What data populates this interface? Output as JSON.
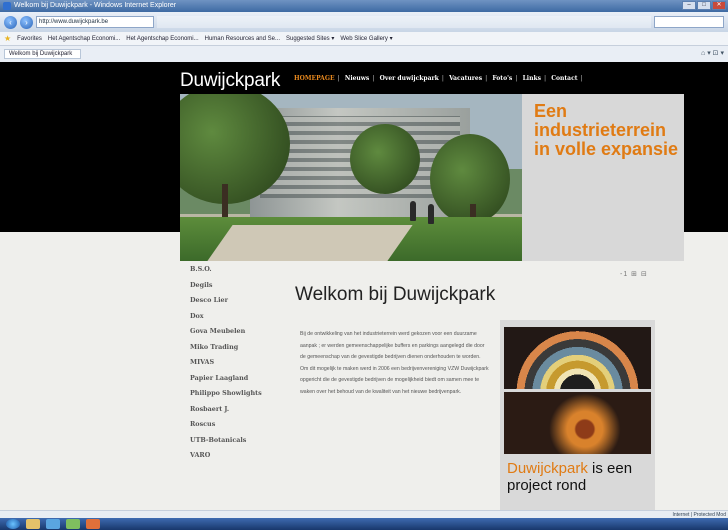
{
  "browser": {
    "title": "Welkom bij Duwijckpark - Windows Internet Explorer",
    "url": "http://www.duwijckpark.be",
    "favorites_label": "Favorites",
    "favorites": [
      "Het Agentschap Economi...",
      "Het Agentschap Economi...",
      "Human Resources and Se...",
      "Suggested Sites ▾",
      "Web Slice Gallery ▾"
    ],
    "tab_label": "Welkom bij Duwijckpark",
    "status_zone": "Internet | Protected Mod"
  },
  "site": {
    "logo": "Duwijckpark",
    "nav": [
      "HOMEPAGE",
      "Nieuws",
      "Over duwijckpark",
      "Vacatures",
      "Foto's",
      "Links",
      "Contact"
    ],
    "hero_tagline": "Een industrieterrein in volle expansie",
    "sidebar": [
      "B.S.O.",
      "Degils",
      "Desco Lier",
      "Dox",
      "Gova Meubelen",
      "Miko Trading",
      "MIVAS",
      "Papier Laagland",
      "Philippo Showlights",
      "Rosbaert J.",
      "Roscus",
      "UTB-Botanicals",
      "VARO"
    ],
    "page_title": "Welkom bij Duwijckpark",
    "intro_meta": "-1 ⊞ ⊟",
    "body": "Bij de ontwikkeling van het industrieterrein werd gekozen voor een duurzame aanpak ; er werden gemeenschappelijke buffers en parkings aangelegd die door de gemeenschap van de gevestigde bedrijven dienen onderhouden te worden. Om dit mogelijk te maken werd in 2006 een bedrijvenvereniging VZW Duwijckpark opgericht die de gevestigde bedrijven de mogelijkheid biedt om samen mee te waken over het behoud van de kwaliteit van het nieuwe bedrijvenpark.",
    "promo_highlight": "Duwijckpark",
    "promo_rest": " is een project rond"
  },
  "colors": {
    "accent": "#e07b14",
    "header_bg": "#000000",
    "page_bg": "#efefec"
  }
}
